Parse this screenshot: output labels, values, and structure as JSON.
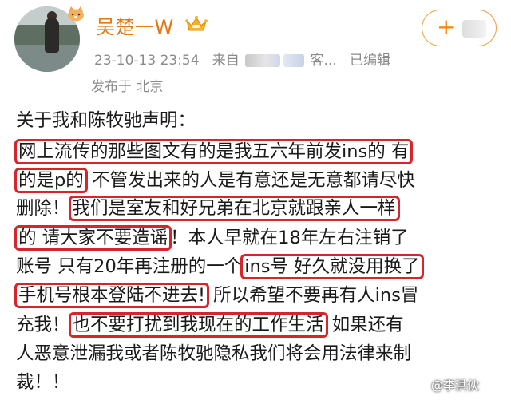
{
  "header": {
    "username": "吴楚一W",
    "timestamp": "23-10-13 23:54",
    "source_prefix": "来自",
    "source_suffix": "客...",
    "edited": "已编辑",
    "location": "发布于 北京",
    "follow_label": "+"
  },
  "post": {
    "lines": [
      "关于我和陈牧驰声明：",
      "网上流传的那些图文有的是我五六年前发ins的 有",
      "的是p的",
      " 不管发出来的人是有意还是无意都请尽快",
      "删除！",
      "我们是室友和好兄弟在北京就跟亲人一样",
      "的 请大家不要造谣",
      "！本人早就在18年左右注销了",
      "账号 只有20年再注册的一个",
      "ins号 好久就没用换了",
      "手机号根本登陆不进去!",
      " 所以希望不要再有人ins冒",
      "充我！",
      "也不要打扰到我现在的工作生活",
      " 如果还有",
      "人恶意泄漏我或者陈牧驰隐私我们将会用法律来制",
      "裁！！"
    ]
  },
  "watermark": "@李洪伙",
  "colors": {
    "username": "#e07a15",
    "highlight_border": "#d7262b",
    "meta": "#8a8a8a"
  },
  "icons": {
    "badge": "cat-badge-icon",
    "vip": "crown-icon"
  }
}
